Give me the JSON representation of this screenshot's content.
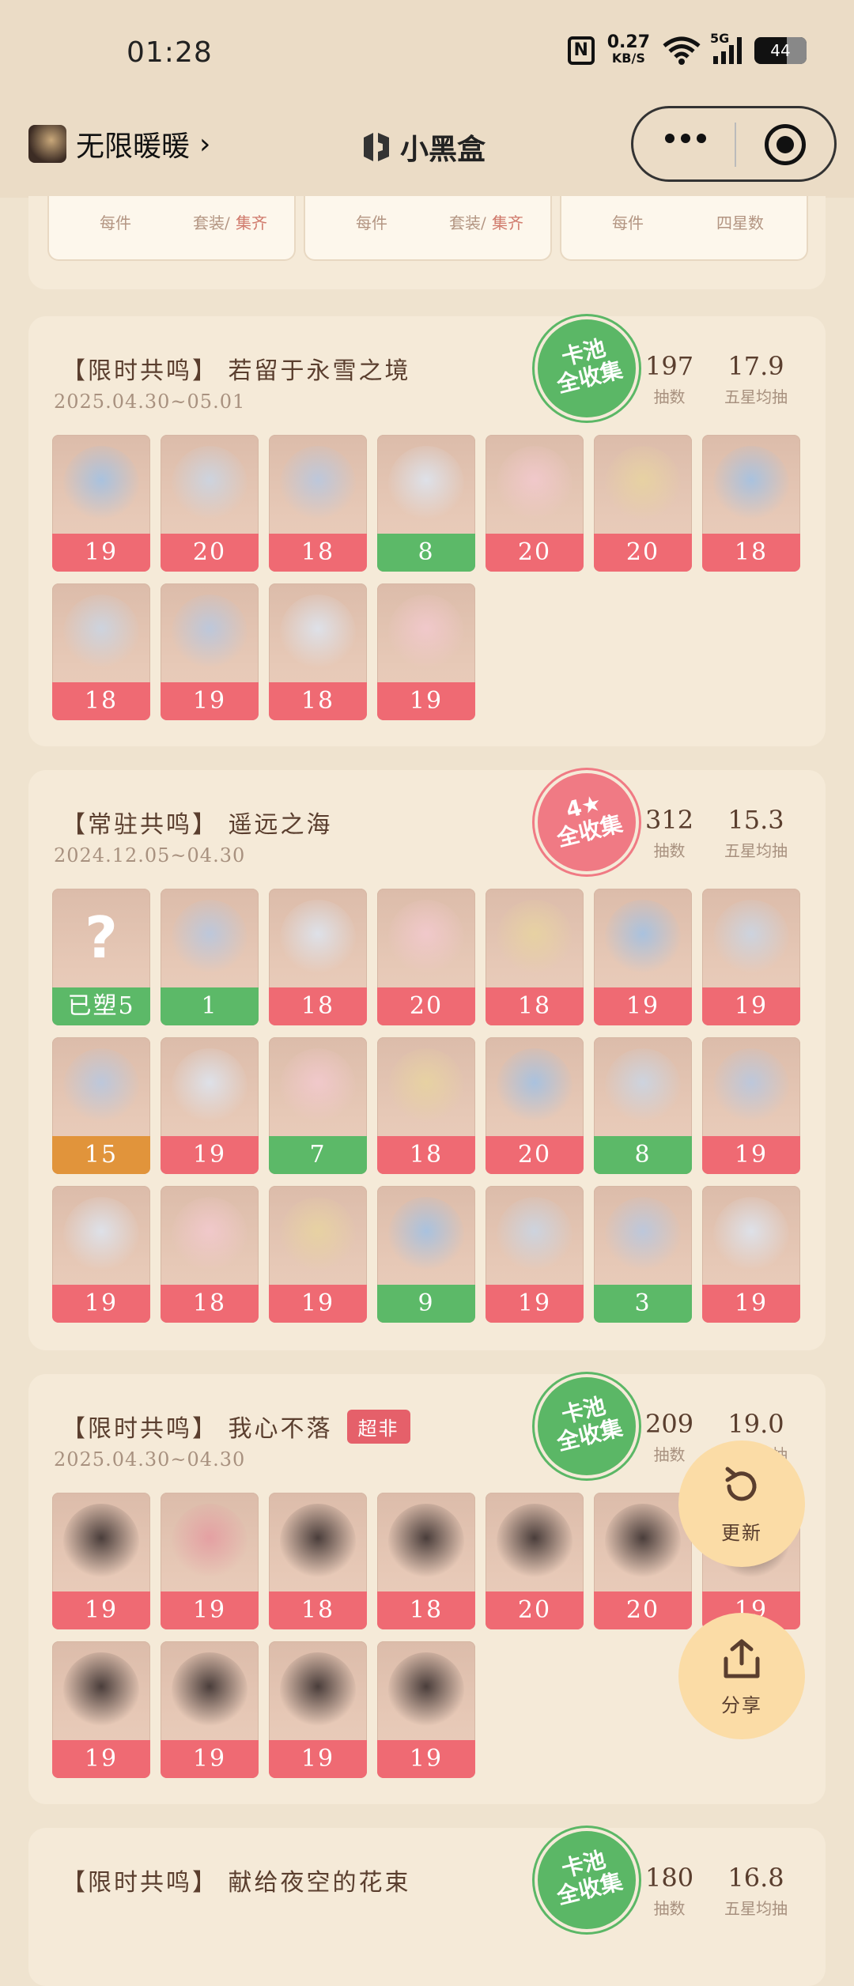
{
  "status": {
    "time": "01:28",
    "nfc": "N",
    "speed_value": "0.27",
    "speed_unit": "KB/S",
    "network": "5G",
    "battery": "44"
  },
  "nav": {
    "title": "无限暖暖",
    "logo_text": "小黑盒"
  },
  "top_card": {
    "boxes": [
      {
        "left": "每件",
        "right_a": "套装/",
        "right_b": "集齐"
      },
      {
        "left": "每件",
        "right_a": "套装/",
        "right_b": "集齐"
      },
      {
        "left": "每件",
        "right_a": "四星数",
        "right_b": ""
      }
    ]
  },
  "pools": [
    {
      "title": "【限时共鸣】 若留于永雪之境",
      "date": "2025.04.30~05.01",
      "seal": [
        "卡池",
        "全收集"
      ],
      "pulls": "197",
      "pulls_label": "抽数",
      "avg": "17.9",
      "avg_label": "五星均抽",
      "items": [
        {
          "v": "19",
          "c": "red"
        },
        {
          "v": "20",
          "c": "red"
        },
        {
          "v": "18",
          "c": "red"
        },
        {
          "v": "8",
          "c": "green"
        },
        {
          "v": "20",
          "c": "red"
        },
        {
          "v": "20",
          "c": "red"
        },
        {
          "v": "18",
          "c": "red"
        },
        {
          "v": "18",
          "c": "red"
        },
        {
          "v": "19",
          "c": "red"
        },
        {
          "v": "18",
          "c": "red"
        },
        {
          "v": "19",
          "c": "red"
        }
      ]
    },
    {
      "title": "【常驻共鸣】 遥远之海",
      "date": "2024.12.05~04.30",
      "seal": [
        "4★",
        "全收集"
      ],
      "pulls": "312",
      "pulls_label": "抽数",
      "avg": "15.3",
      "avg_label": "五星均抽",
      "items": [
        {
          "v": "已塑5",
          "c": "green",
          "q": "?"
        },
        {
          "v": "1",
          "c": "green"
        },
        {
          "v": "18",
          "c": "red"
        },
        {
          "v": "20",
          "c": "red"
        },
        {
          "v": "18",
          "c": "red"
        },
        {
          "v": "19",
          "c": "red"
        },
        {
          "v": "19",
          "c": "red"
        },
        {
          "v": "15",
          "c": "orange"
        },
        {
          "v": "19",
          "c": "red"
        },
        {
          "v": "7",
          "c": "green"
        },
        {
          "v": "18",
          "c": "red"
        },
        {
          "v": "20",
          "c": "red"
        },
        {
          "v": "8",
          "c": "green"
        },
        {
          "v": "19",
          "c": "red"
        },
        {
          "v": "19",
          "c": "red"
        },
        {
          "v": "18",
          "c": "red"
        },
        {
          "v": "19",
          "c": "red"
        },
        {
          "v": "9",
          "c": "green"
        },
        {
          "v": "19",
          "c": "red"
        },
        {
          "v": "3",
          "c": "green"
        },
        {
          "v": "19",
          "c": "red"
        }
      ]
    },
    {
      "title": "【限时共鸣】 我心不落",
      "chip": "超非",
      "date": "2025.04.30~04.30",
      "seal": [
        "卡池",
        "全收集"
      ],
      "pulls": "209",
      "pulls_label": "抽数",
      "avg": "19.0",
      "avg_label": "五星均抽",
      "items": [
        {
          "v": "19",
          "c": "red"
        },
        {
          "v": "19",
          "c": "red"
        },
        {
          "v": "18",
          "c": "red"
        },
        {
          "v": "18",
          "c": "red"
        },
        {
          "v": "20",
          "c": "red"
        },
        {
          "v": "20",
          "c": "red"
        },
        {
          "v": "19",
          "c": "red"
        },
        {
          "v": "19",
          "c": "red"
        },
        {
          "v": "19",
          "c": "red"
        },
        {
          "v": "19",
          "c": "red"
        },
        {
          "v": "19",
          "c": "red"
        }
      ]
    },
    {
      "title": "【限时共鸣】 献给夜空的花束",
      "date": "",
      "seal": [
        "卡池",
        "全收集"
      ],
      "pulls": "180",
      "pulls_label": "抽数",
      "avg": "16.8",
      "avg_label": "五星均抽",
      "items": []
    }
  ],
  "fab": {
    "refresh": "更新",
    "share": "分享"
  },
  "colors": {
    "red": "#ef6a73",
    "green": "#5cb968",
    "orange": "#e1943b",
    "background": "#efe3cf"
  }
}
